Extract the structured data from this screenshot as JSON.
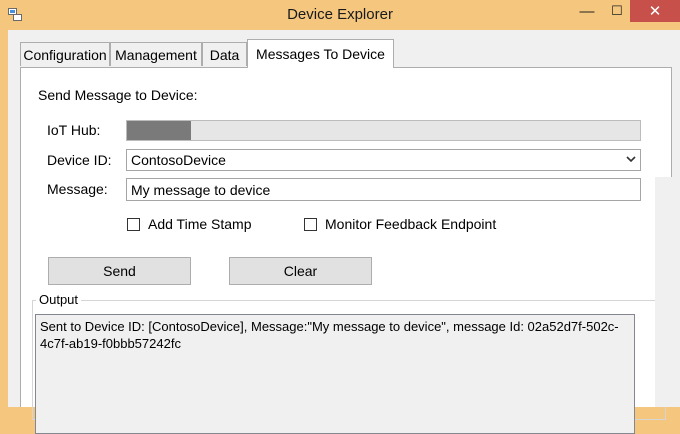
{
  "window": {
    "title": "Device Explorer"
  },
  "tabs": [
    {
      "label": "Configuration",
      "active": false
    },
    {
      "label": "Management",
      "active": false
    },
    {
      "label": "Data",
      "active": false
    },
    {
      "label": "Messages To Device",
      "active": true
    }
  ],
  "send_panel": {
    "heading": "Send Message to Device:",
    "iot_hub": {
      "label": "IoT Hub:",
      "value_redacted": true
    },
    "device_id": {
      "label": "Device ID:",
      "selected": "ContosoDevice"
    },
    "message": {
      "label": "Message:",
      "value": "My message to device"
    },
    "add_timestamp": {
      "label": "Add Time Stamp",
      "checked": false
    },
    "monitor_feedback": {
      "label": "Monitor Feedback Endpoint",
      "checked": false
    },
    "send_label": "Send",
    "clear_label": "Clear"
  },
  "output": {
    "label": "Output",
    "text": "Sent to Device ID: [ContosoDevice], Message:\"My message to device\", message Id: 02a52d7f-502c-4c7f-ab19-f0bbb57242fc"
  },
  "colors": {
    "titlebar": "#f5c77e",
    "close_button": "#c7504b",
    "panel": "#f0f0f0"
  }
}
